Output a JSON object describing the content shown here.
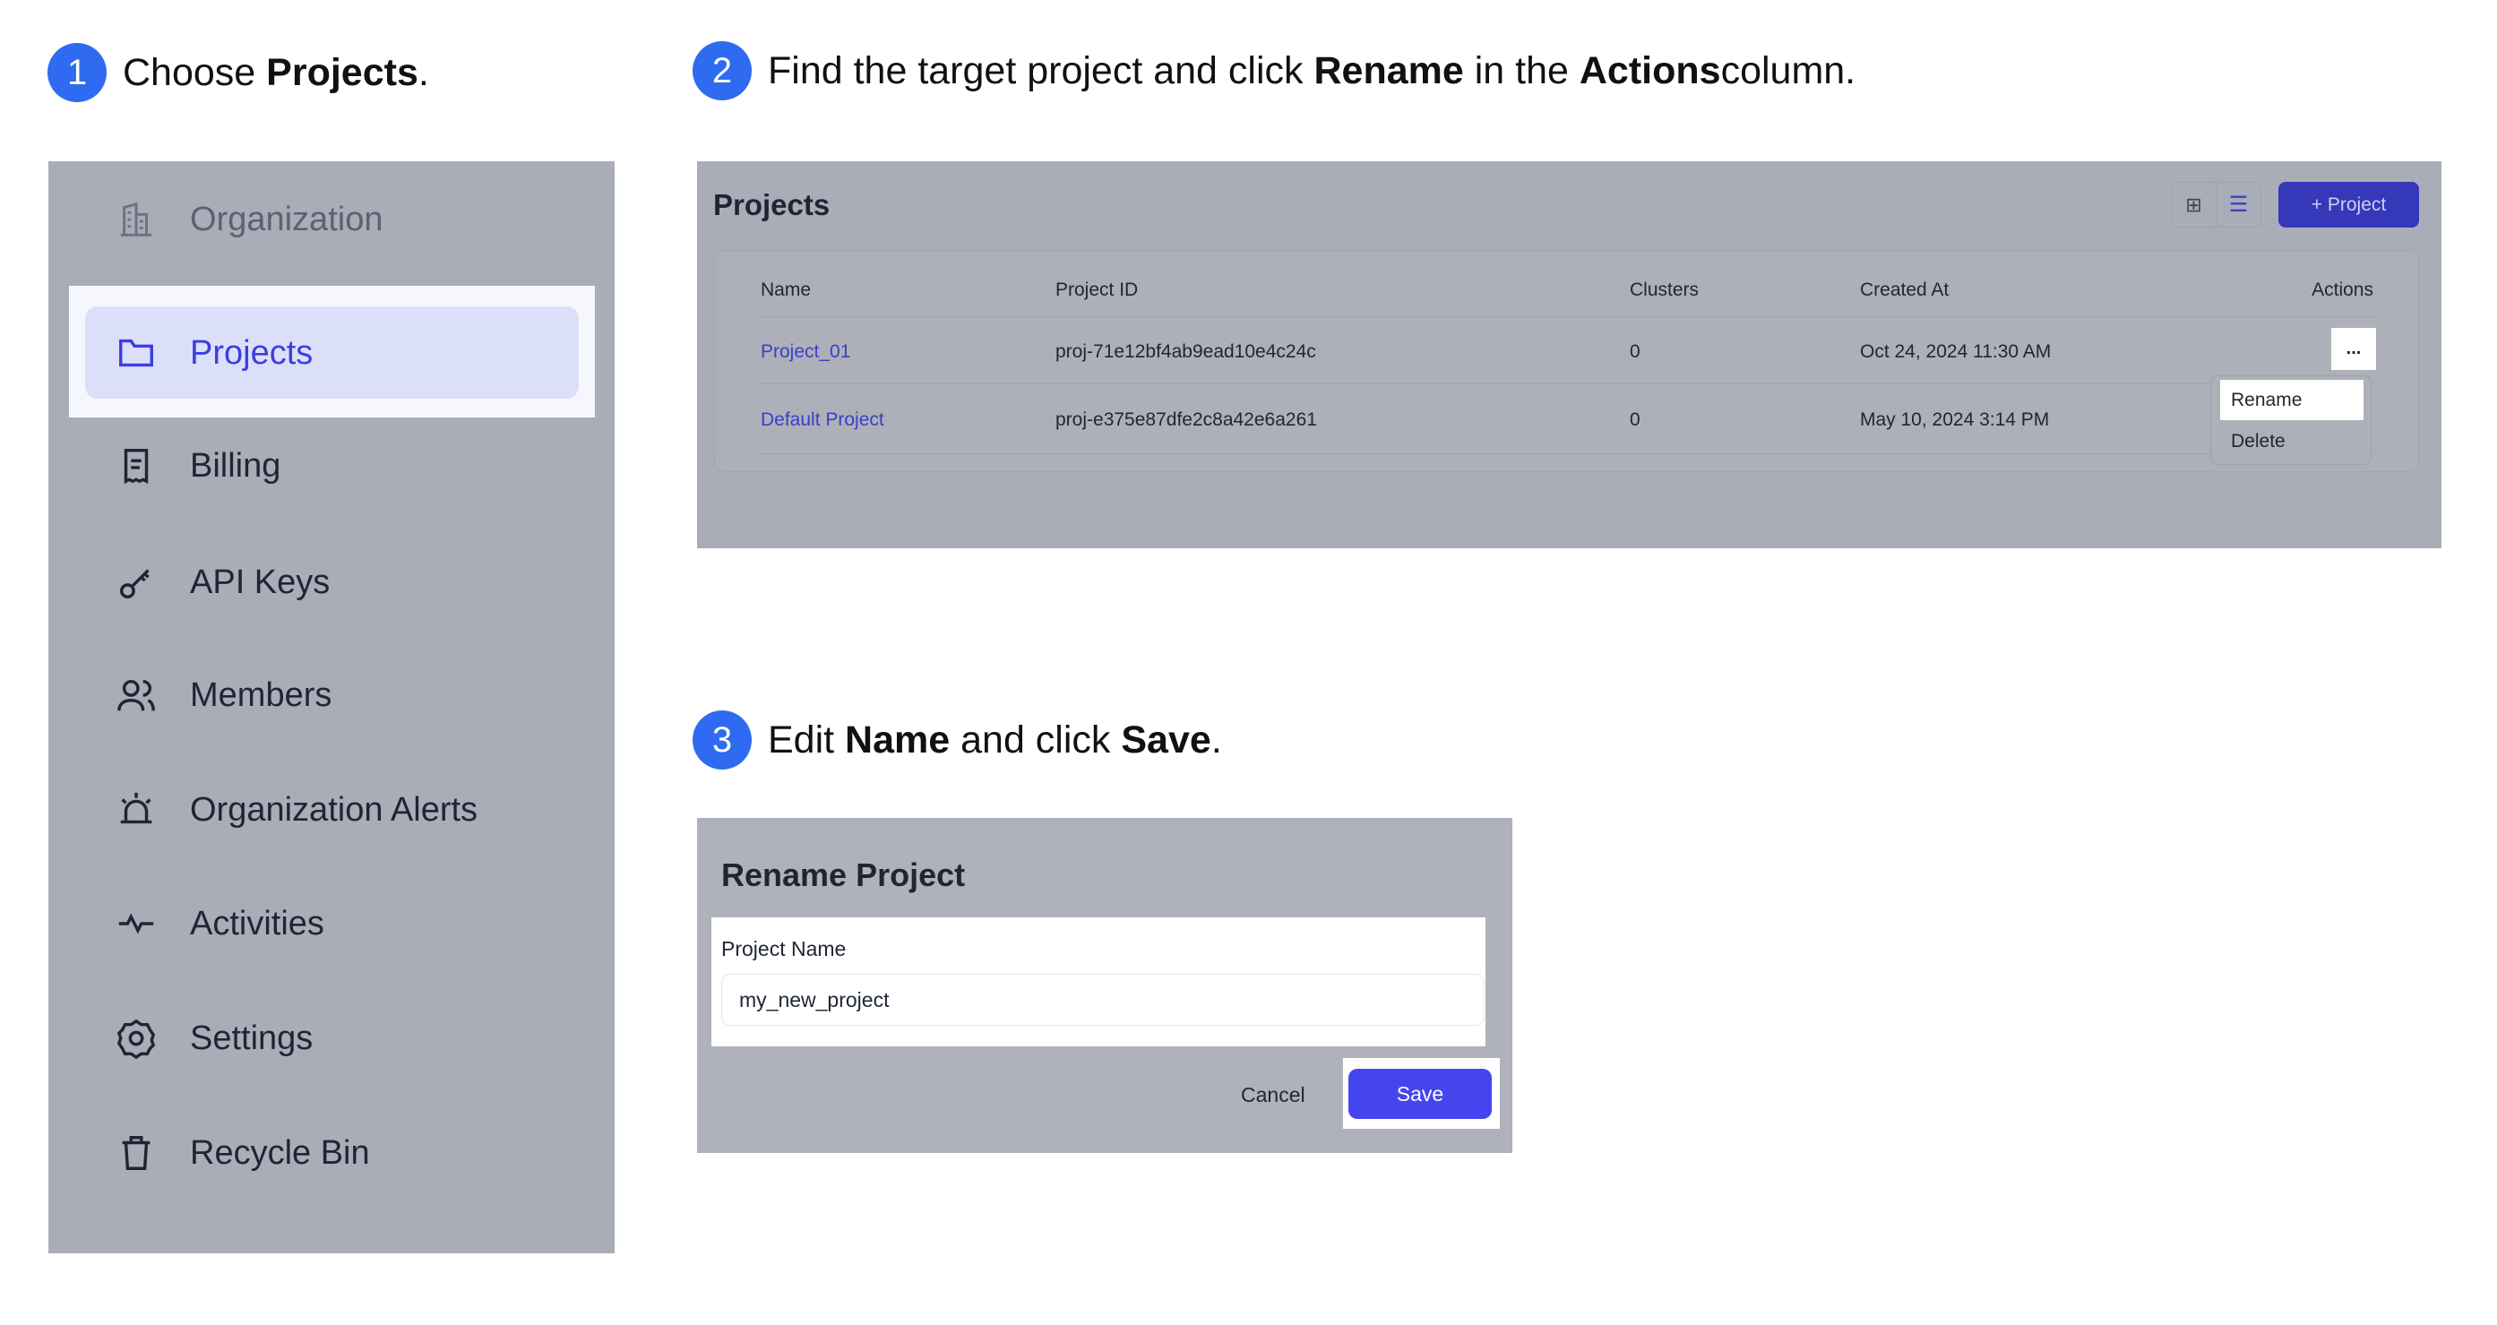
{
  "steps": [
    {
      "num": "1",
      "pre": "Choose ",
      "bold": "Projects",
      "post": "."
    },
    {
      "num": "2",
      "pre": "Find the target project and click ",
      "bold": "Rename",
      "mid": " in the ",
      "bold2": "Actions",
      "post": " column."
    },
    {
      "num": "3",
      "pre": "Edit ",
      "bold": "Name",
      "mid": " and click ",
      "bold2": "Save",
      "post": "."
    }
  ],
  "sidebar": {
    "items": [
      {
        "label": "Organization",
        "icon": "building-icon"
      },
      {
        "label": "Projects",
        "icon": "folder-icon",
        "active": true
      },
      {
        "label": "Billing",
        "icon": "receipt-icon"
      },
      {
        "label": "API Keys",
        "icon": "key-icon"
      },
      {
        "label": "Members",
        "icon": "users-icon"
      },
      {
        "label": "Organization Alerts",
        "icon": "alarm-icon"
      },
      {
        "label": "Activities",
        "icon": "activity-icon"
      },
      {
        "label": "Settings",
        "icon": "gear-icon"
      },
      {
        "label": "Recycle Bin",
        "icon": "trash-icon"
      }
    ]
  },
  "projects": {
    "title": "Projects",
    "new_button": "+ Project",
    "columns": [
      "Name",
      "Project ID",
      "Clusters",
      "Created At",
      "Actions"
    ],
    "rows": [
      {
        "name": "Project_01",
        "id": "proj-71e12bf4ab9ead10e4c24c",
        "clusters": "0",
        "created": "Oct 24, 2024 11:30 AM"
      },
      {
        "name": "Default Project",
        "id": "proj-e375e87dfe2c8a42e6a261",
        "clusters": "0",
        "created": "May 10, 2024 3:14 PM"
      }
    ],
    "actions_button": "...",
    "menu": [
      "Rename",
      "Delete"
    ]
  },
  "dialog": {
    "title": "Rename Project",
    "label": "Project Name",
    "value": "my_new_project",
    "cancel": "Cancel",
    "save": "Save"
  },
  "colors": {
    "accent": "#4545f0",
    "brand_dark": "#3538b8",
    "overlay": "#a9adb8",
    "step": "#2f6bf0"
  }
}
